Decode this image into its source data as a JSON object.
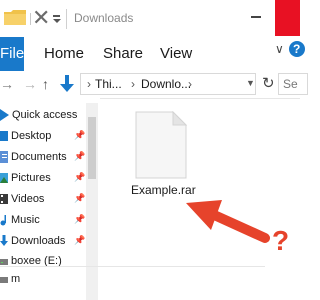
{
  "window": {
    "title": "Downloads",
    "ribbon_toggle": "∨",
    "help": "?"
  },
  "ribbon": {
    "tabs": [
      "File",
      "Home",
      "Share",
      "View"
    ]
  },
  "nav": {
    "back": "→",
    "forward": "→",
    "up": "↑",
    "chevron": "›",
    "segments": [
      "Thi...",
      "Downlo..."
    ],
    "dropdown": "▼",
    "refresh": "↻",
    "search_placeholder": "Se"
  },
  "sidebar": {
    "quick_access": "Quick access",
    "items": [
      {
        "label": "Desktop",
        "icon": "desktop-icon",
        "pinned": true
      },
      {
        "label": "Documents",
        "icon": "documents-icon",
        "pinned": true
      },
      {
        "label": "Pictures",
        "icon": "pictures-icon",
        "pinned": true
      },
      {
        "label": "Videos",
        "icon": "videos-icon",
        "pinned": true
      },
      {
        "label": "Music",
        "icon": "music-icon",
        "pinned": true
      },
      {
        "label": "Downloads",
        "icon": "downloads-icon",
        "pinned": true
      },
      {
        "label": "boxee (E:)",
        "icon": "drive-icon",
        "pinned": false
      },
      {
        "label": "m",
        "icon": "drive-icon",
        "pinned": false
      }
    ]
  },
  "content": {
    "file_name": "Example.rar",
    "file_icon": "file-icon"
  },
  "annotation": {
    "mark": "?",
    "color": "#e6432b"
  },
  "colors": {
    "accent": "#1979ca",
    "close": "#e81123"
  }
}
